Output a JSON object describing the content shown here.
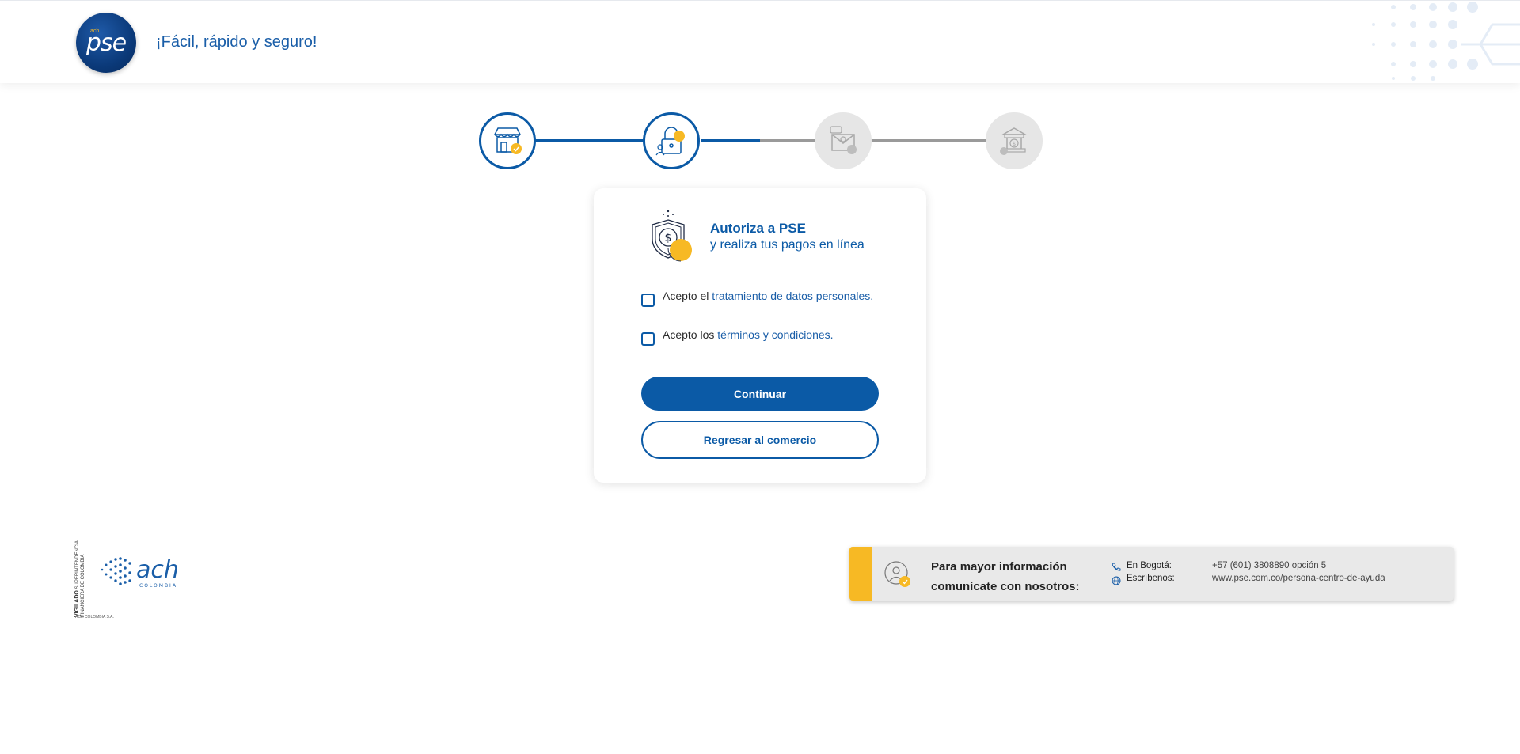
{
  "header": {
    "logo_text": "pse",
    "logo_small": "ach",
    "tagline": "¡Fácil, rápido y seguro!"
  },
  "stepper": {
    "steps": [
      {
        "icon": "store-icon",
        "status": "completed"
      },
      {
        "icon": "lock-icon",
        "status": "current"
      },
      {
        "icon": "envelope-icon",
        "status": "pending"
      },
      {
        "icon": "bank-icon",
        "status": "pending"
      }
    ],
    "colors": {
      "active": "#0b5aa6",
      "inactive": "#9a9a9a",
      "accent": "#f7b924"
    }
  },
  "card": {
    "title": "Autoriza a PSE",
    "subtitle": "y realiza tus pagos en línea",
    "consent_data": {
      "prefix": "Acepto el",
      "link": "tratamiento de datos personales."
    },
    "consent_terms": {
      "prefix": "Acepto los",
      "link": "términos y condiciones."
    },
    "continue_label": "Continuar",
    "back_label": "Regresar al comercio"
  },
  "footer": {
    "vigilado_bold": "VIGILADO",
    "vigilado_text": "SUPERINTENDENCIA FINANCIERA DE COLOMBIA",
    "ach_logo_text": "ach",
    "ach_logo_sub": "COLOMBIA",
    "company": "ACH COLOMBIA S.A.",
    "info": {
      "title_line1": "Para mayor información",
      "title_line2": "comunícate con nosotros:",
      "phone_label": "En Bogotá:",
      "phone_value": "+57 (601) 3808890 opción 5",
      "web_label": "Escríbenos:",
      "web_value": "www.pse.com.co/persona-centro-de-ayuda"
    }
  }
}
